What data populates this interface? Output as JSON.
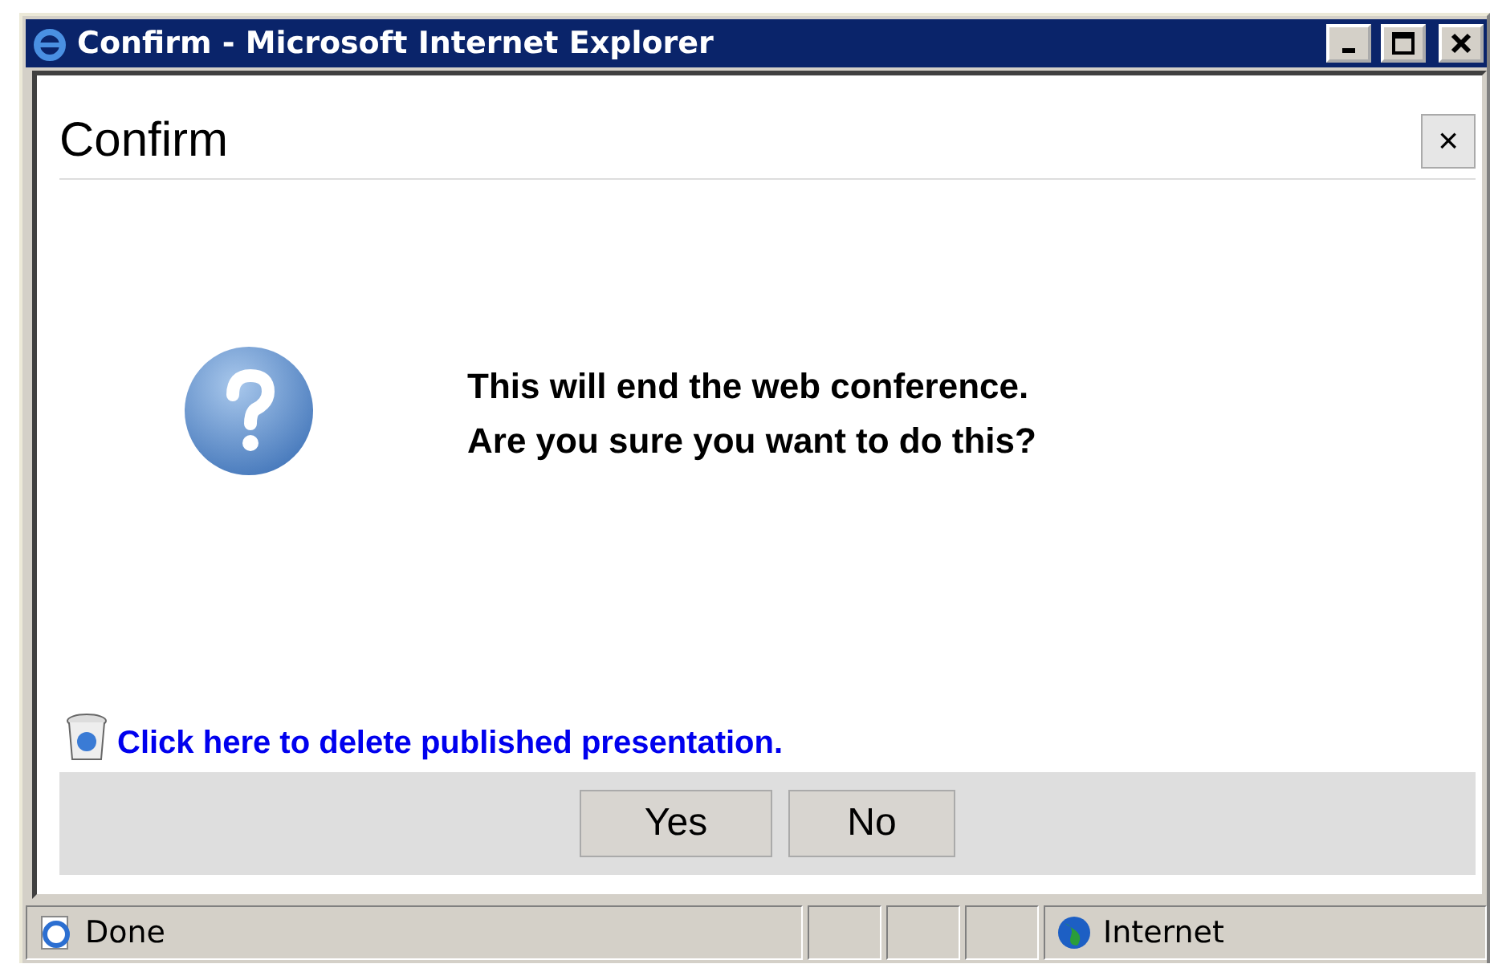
{
  "window": {
    "title": "Confirm - Microsoft Internet Explorer"
  },
  "dialog": {
    "title": "Confirm",
    "close": "×",
    "message": [
      "This will end the web conference.",
      "Are you sure you want to do this?"
    ],
    "link": "Click here to delete published presentation.",
    "buttons": [
      "Yes",
      "No"
    ]
  },
  "status_bar": {
    "text": "Done",
    "zone": "Internet"
  }
}
